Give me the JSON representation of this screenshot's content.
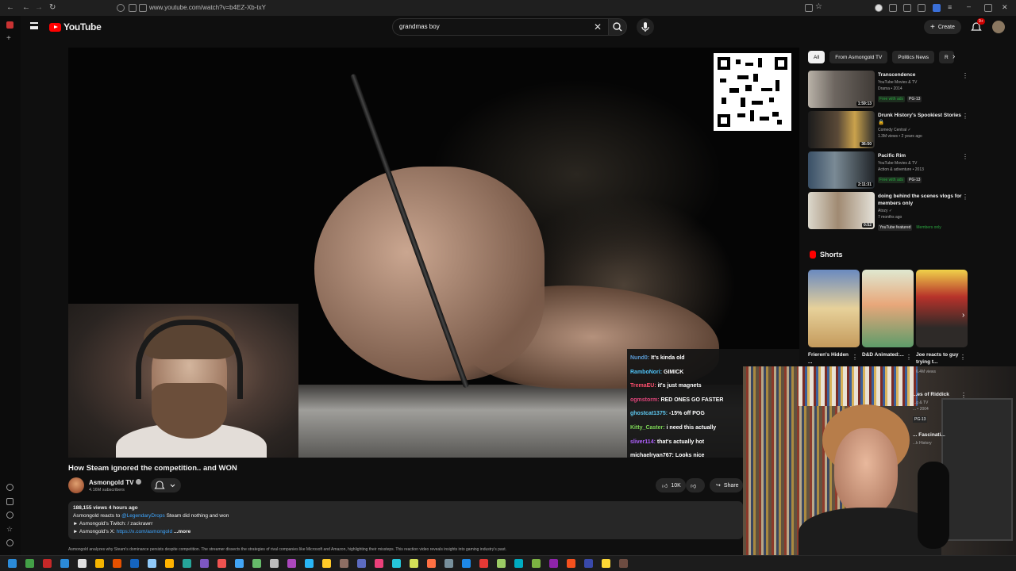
{
  "browser": {
    "url": "www.youtube.com/watch?v=b4EZ-Xb-txY"
  },
  "header": {
    "logo_text": "YouTube",
    "search_value": "grandmas boy",
    "create_label": "Create",
    "notification_count": "9+"
  },
  "player": {
    "chat": [
      {
        "user": "Nund0:",
        "msg": "It's kinda old",
        "color": "#5b9bd5"
      },
      {
        "user": "RamboNori:",
        "msg": "GIMICK",
        "color": "#4fc3f7"
      },
      {
        "user": "TremaEU:",
        "msg": "it's just magnets",
        "color": "#ff4f6e"
      },
      {
        "user": "ogmstorm:",
        "msg": "RED ONES GO FASTER",
        "color": "#e0457b"
      },
      {
        "user": "ghostcat1375:",
        "msg": "-15% off POG",
        "color": "#5ec8f0"
      },
      {
        "user": "Kitty_Caster:",
        "msg": "i need this actually",
        "color": "#7ed957"
      },
      {
        "user": "sliver114:",
        "msg": "that's actually hot",
        "color": "#b061ff"
      },
      {
        "user": "michaelryan767:",
        "msg": "Looks nice",
        "color": "#ffffff"
      }
    ]
  },
  "video": {
    "title": "How Steam ignored the competition.. and WON",
    "channel": "Asmongold TV",
    "subscribers": "4.16M subscribers",
    "likes": "10K",
    "share_label": "Share",
    "stats": "188,155 views  4 hours ago",
    "desc_line1_pre": "Asmongold reacts to",
    "desc_line1_link": "@LegendaryDrops",
    "desc_line1_post": "Steam did nothing and won",
    "desc_line2": "► Asmongold's Twitch: / zackrawrr",
    "desc_line3_pre": "► Asmongold's X:",
    "desc_line3_link": "https://x.com/asmongold",
    "more_label": "...more",
    "desc_bottom": "Asmongold analyzes why Steam's dominance persists despite competition. The streamer dissects the strategies of rival companies like Microsoft and Amazon, highlighting their missteps. This reaction video reveals insights into gaming industry's past."
  },
  "sidebar": {
    "filters": [
      "All",
      "From Asmongold TV",
      "Politics News",
      "R"
    ],
    "recommendations": [
      {
        "title": "Transcendence",
        "meta1": "YouTube Movies & TV",
        "meta2": "Drama • 2014",
        "badge_free": "Free with ads",
        "badge_rating": "PG-13",
        "duration": "1:59:13"
      },
      {
        "title": "Drunk History's Spookiest Stories 🔒",
        "meta1": "Comedy Central ✓",
        "meta2": "1.3M views • 2 years ago",
        "duration": "36:50"
      },
      {
        "title": "Pacific Rim",
        "meta1": "YouTube Movies & TV",
        "meta2": "Action & adventure • 2013",
        "badge_free": "Free with ads",
        "badge_rating": "PG-13",
        "duration": "2:11:31"
      },
      {
        "title": "doing behind the scenes vlogs for members only",
        "meta1": "Atozy ✓",
        "meta2": "7 months ago",
        "badge_featured": "YouTube featured",
        "badge_members": "Members only",
        "duration": "0:52"
      }
    ],
    "shorts_label": "Shorts",
    "shorts": [
      {
        "title": "Frieren's Hidden ...",
        "views": ""
      },
      {
        "title": "D&D Animated:...",
        "views": ""
      },
      {
        "title": "Joe reacts to guy trying t...",
        "views": "6.4M views"
      }
    ],
    "partial_rec": {
      "title": "...es of Riddick",
      "meta1": "...g & TV",
      "meta2": "... • 2004",
      "rating": "PG-13",
      "title2": "... Fascinati...",
      "meta3": "...k History"
    }
  },
  "colors": {
    "brand_red": "#ff0000",
    "background": "#0f0f0f",
    "surface": "#272727",
    "link": "#3ea6ff"
  }
}
